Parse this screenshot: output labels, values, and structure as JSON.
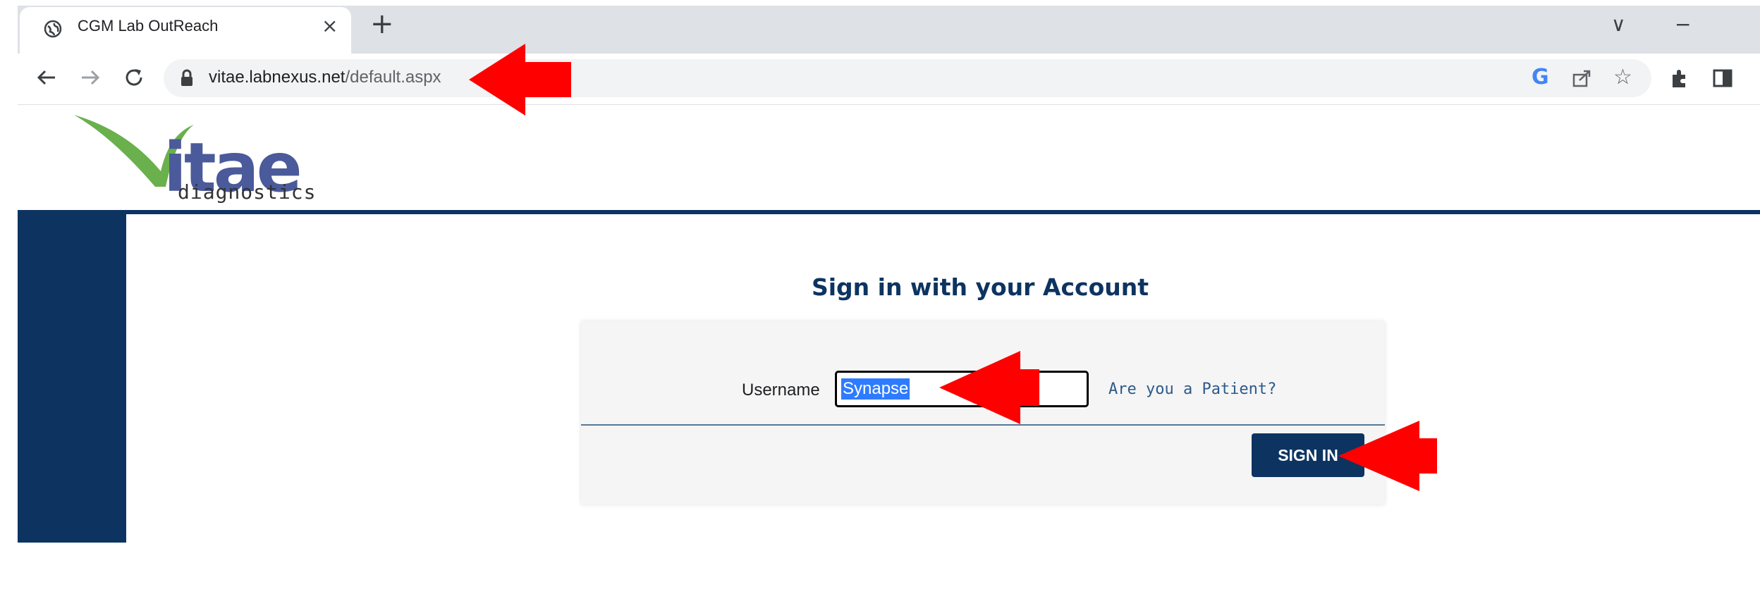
{
  "browser": {
    "tab_title": "CGM Lab OutReach",
    "tab_close": "×",
    "new_tab": "+",
    "url_host": "vitae.labnexus.net",
    "url_path": "/default.aspx",
    "win_dropdown": "∨",
    "win_minimize": "−"
  },
  "logo": {
    "wordmark": "itae",
    "sub": "diagnostics"
  },
  "login": {
    "heading": "Sign in with your Account",
    "username_label": "Username",
    "username_value": "Synapse",
    "patient_link": "Are you a Patient?",
    "signin_label": "SIGN IN"
  },
  "colors": {
    "brand_navy": "#0d3461",
    "logo_green": "#6ab04c",
    "logo_blue": "#4a5a9a",
    "annotation_red": "#ff0000"
  },
  "icons": [
    "globe-icon",
    "close-icon",
    "plus-icon",
    "back-arrow-icon",
    "forward-arrow-icon",
    "reload-icon",
    "lock-icon",
    "google-icon",
    "share-icon",
    "star-icon",
    "extensions-icon",
    "side-panel-icon",
    "annotation-arrow-icon"
  ]
}
